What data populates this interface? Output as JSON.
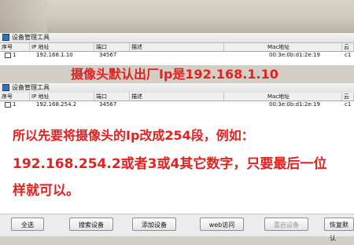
{
  "window": {
    "title": "设备管理工具"
  },
  "columns": [
    "序号",
    "IP 地址",
    "端口",
    "描述",
    "Mac地址",
    "云"
  ],
  "grid1": {
    "rows": [
      {
        "index": "1",
        "ip": "192.168.1.10",
        "port": "34567",
        "desc": "",
        "mac": "00:3e:0b:d1:2e:19",
        "cloud": "c1"
      }
    ]
  },
  "grid2": {
    "rows": [
      {
        "index": "1",
        "ip": "192.168.254.2",
        "port": "34567",
        "desc": "",
        "mac": "00:3e:0b:d1:2e:19",
        "cloud": "c1"
      }
    ]
  },
  "annotations": {
    "note1": "摄像头默认出厂Ip是192.168.1.10",
    "note2_line1": "所以先要将摄像头的Ip改成254段，例如：",
    "note2_line2": "192.168.254.2或者3或4其它数字，只要最后一位",
    "note2_line3": "样就可以。"
  },
  "buttons": {
    "select_all": "全选",
    "search": "搜索设备",
    "add": "添加设备",
    "web": "web访问",
    "reboot": "重启设备",
    "restore": "恢复默认"
  },
  "colors": {
    "annotation": "#e3211f",
    "window_bg": "#ffffff",
    "title_bar": "#eaeaea"
  }
}
